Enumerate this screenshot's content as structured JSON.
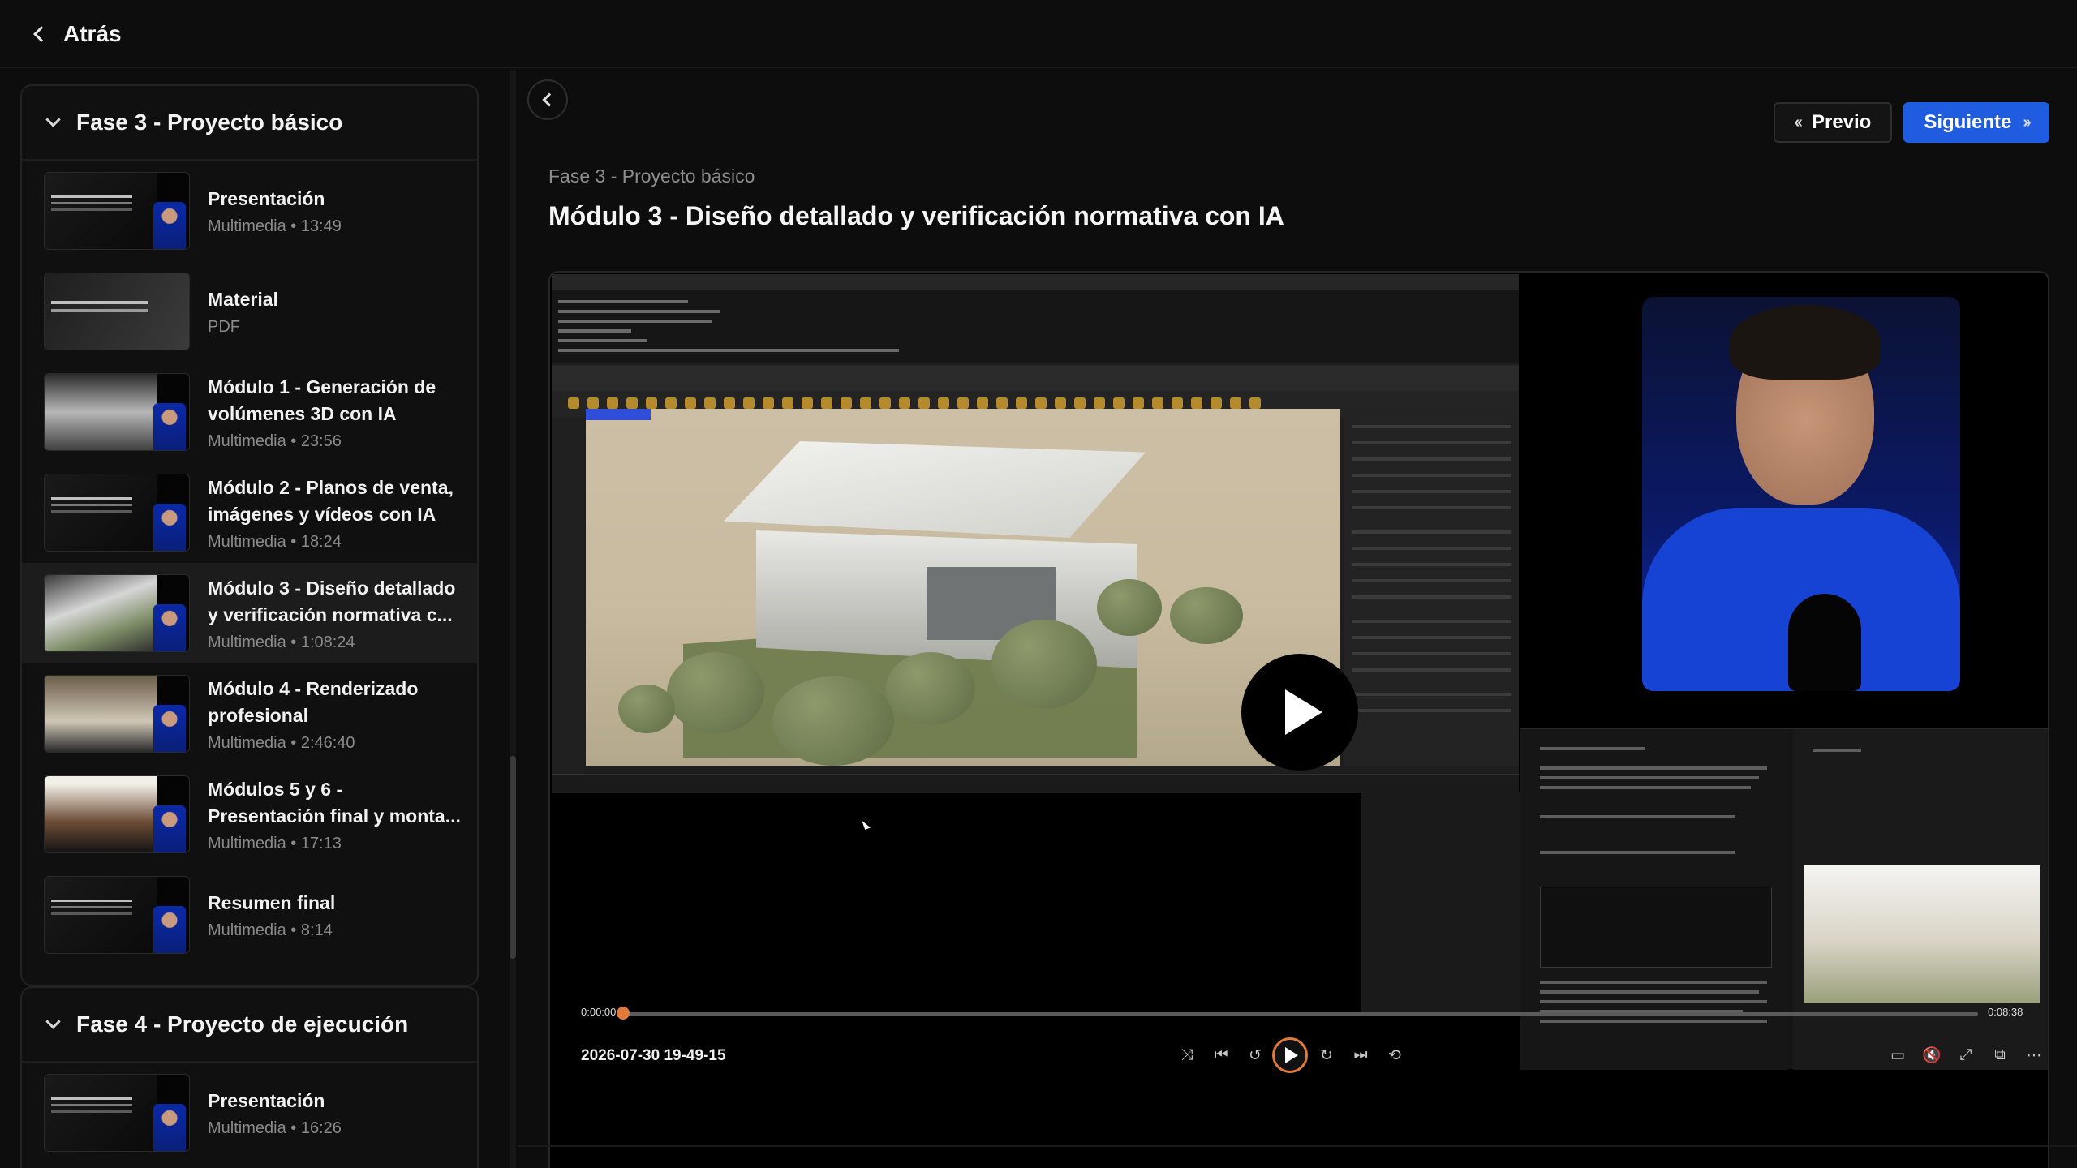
{
  "topbar": {
    "back_label": "Atrás"
  },
  "sidebar": {
    "sections": [
      {
        "title": "Fase 3 - Proyecto básico",
        "lessons": [
          {
            "title": "Presentación",
            "meta": "Multimedia • 13:49"
          },
          {
            "title": "Material",
            "meta": "PDF"
          },
          {
            "title": "Módulo 1 - Generación de volúmenes 3D con IA",
            "meta": "Multimedia • 23:56"
          },
          {
            "title": "Módulo 2 - Planos de venta, imágenes y vídeos con IA",
            "meta": "Multimedia • 18:24"
          },
          {
            "title": "Módulo 3 - Diseño detallado y verificación normativa c...",
            "meta": "Multimedia • 1:08:24",
            "active": true
          },
          {
            "title": "Módulo 4 - Renderizado profesional",
            "meta": "Multimedia • 2:46:40"
          },
          {
            "title": "Módulos 5 y 6 - Presentación final y monta...",
            "meta": "Multimedia • 17:13"
          },
          {
            "title": "Resumen final",
            "meta": "Multimedia • 8:14"
          }
        ]
      },
      {
        "title": "Fase 4 - Proyecto de ejecución",
        "lessons": [
          {
            "title": "Presentación",
            "meta": "Multimedia • 16:26"
          }
        ]
      }
    ]
  },
  "main": {
    "prev_label": "Previo",
    "next_label": "Siguiente",
    "breadcrumb": "Fase 3 - Proyecto básico",
    "title": "Módulo 3 - Diseño detallado y verificación normativa con IA",
    "accent_color": "#1f5ce0"
  },
  "player": {
    "current_time": "0:00:00",
    "total_time": "0:08:38",
    "recording_name": "2026-07-30 19-49-15",
    "progress": 0.0,
    "progress_color": "#e07a3a"
  }
}
